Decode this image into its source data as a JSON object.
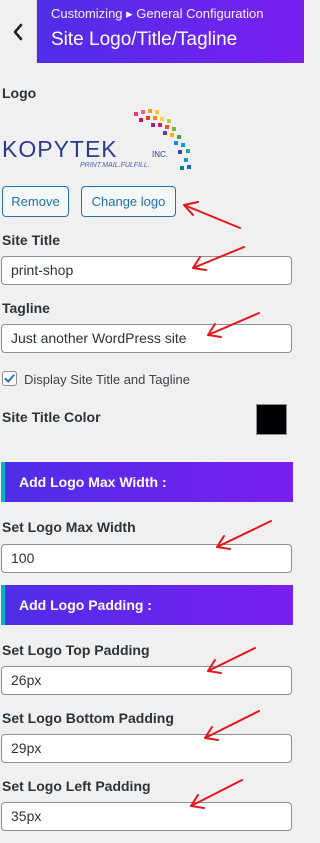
{
  "header": {
    "breadcrumb": "Customizing ▸ General Configuration",
    "title": "Site Logo/Title/Tagline"
  },
  "logo_section": {
    "label": "Logo",
    "logo_text": "KOPYTEK",
    "logo_suffix": "INC.",
    "logo_tagline": "PRINT.MAIL.FULFILL.",
    "remove_label": "Remove",
    "change_label": "Change logo"
  },
  "site_title": {
    "label": "Site Title",
    "value": "print-shop"
  },
  "tagline": {
    "label": "Tagline",
    "value": "Just another WordPress site"
  },
  "display_toggle": {
    "label": "Display Site Title and Tagline",
    "checked": true
  },
  "title_color": {
    "label": "Site Title Color",
    "value": "#000000"
  },
  "max_width_section": {
    "heading": "Add Logo Max Width :",
    "label": "Set Logo Max Width",
    "value": "100"
  },
  "padding_section": {
    "heading": "Add Logo Padding :",
    "top": {
      "label": "Set Logo Top Padding",
      "value": "26px"
    },
    "bottom": {
      "label": "Set Logo Bottom Padding",
      "value": "29px"
    },
    "left": {
      "label": "Set Logo Left Padding",
      "value": "35px"
    }
  },
  "colors": {
    "accent_start": "#4f2ee8",
    "accent_end": "#7a1ff0",
    "band_edge": "#00b3c6",
    "link": "#2271b1",
    "annotation_arrow": "#e8141c"
  }
}
